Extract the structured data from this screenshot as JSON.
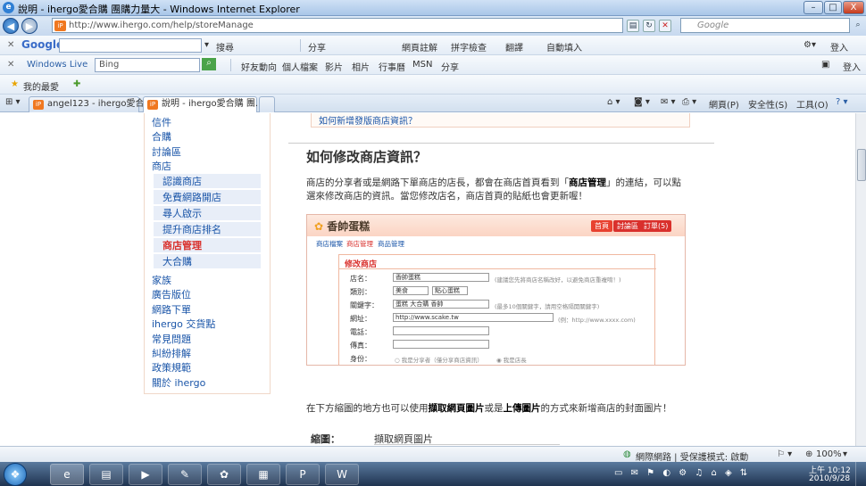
{
  "window": {
    "title": "說明 - ihergo愛合購 團購力量大 - Windows Internet Explorer",
    "controls": {
      "minimize": "–",
      "maximize": "□",
      "close": "X"
    }
  },
  "address_bar": {
    "url": "http://www.ihergo.com/help/storeManage",
    "search_placeholder": "Google"
  },
  "google_toolbar": {
    "logo": "Google",
    "items": [
      "搜尋",
      "分享",
      "網頁註解",
      "拼字檢查",
      "翻譯",
      "自動填入"
    ],
    "signin": "登入"
  },
  "live_toolbar": {
    "logo": "Windows Live",
    "search_value": "Bing",
    "links": [
      "好友動向",
      "個人檔案",
      "影片",
      "相片",
      "行事曆",
      "MSN",
      "分享"
    ],
    "signin": "登入"
  },
  "favorites_bar": {
    "label": "我的最愛"
  },
  "tabs": [
    {
      "label": "angel123 - ihergo愛合購",
      "active": false
    },
    {
      "label": "說明 - ihergo愛合購 團...",
      "active": true
    }
  ],
  "command_bar": {
    "page": "網頁(P)",
    "safety": "安全性(S)",
    "tools": "工具(O)"
  },
  "top_link": "如何新增發版商店資訊？",
  "sidebar": {
    "items_top": [
      "信件",
      "合購",
      "討論區",
      "商店"
    ],
    "sub_items": [
      "認識商店",
      "免費網路開店",
      "尋人啟示",
      "提升商店排名",
      "商店管理",
      "大合購"
    ],
    "current_sub": "商店管理",
    "items_bottom": [
      "家族",
      "廣告版位",
      "網路下單",
      "ihergo 交貨點",
      "常見問題",
      "糾紛排解",
      "政策規範",
      "關於 ihergo"
    ]
  },
  "article": {
    "heading": "如何修改商店資訊？",
    "para1_a": "商店的分享者或是網路下單商店的店長，都會在商店首頁看到「",
    "para1_bold": "商店管理",
    "para1_b": "」的連結，可以點",
    "para2": "選來修改商店的資訊。當您修改店名，商店首頁的貼紙也會更新喔！",
    "para3_a": "在下方縮圖的地方也可以使用",
    "para3_bold1": "擷取網頁圖片",
    "para3_b": "或是",
    "para3_bold2": "上傳圖片",
    "para3_c": "的方式來新增商店的封面圖片！",
    "thumb_label": "縮圖：",
    "thumb_value": "擷取網頁圖片"
  },
  "embedded": {
    "store_name": "香帥蛋糕",
    "buttons": [
      "首頁",
      "討論區",
      "訂單(5)"
    ],
    "sub_links": [
      "商店檔案",
      "商店管理",
      "商品管理"
    ],
    "form_title": "修改商店",
    "fields": [
      {
        "label": "店名：",
        "value": "香帥蛋糕",
        "note": "(建議您先將商店名稱改好，以避免商店重複唷！)"
      },
      {
        "label": "類別：",
        "value": "美食",
        "value2": "點心蛋糕",
        "note": ""
      },
      {
        "label": "關鍵字：",
        "value": "蛋糕 大合購 香帥",
        "note": "(最多10個關鍵字，請用空格隔開關鍵字)"
      },
      {
        "label": "網址：",
        "value": "http://www.scake.tw",
        "note": "(例：http://www.xxxx.com)"
      },
      {
        "label": "電話：",
        "value": "",
        "note": ""
      },
      {
        "label": "傳真：",
        "value": "",
        "note": ""
      },
      {
        "label": "身份：",
        "value": "",
        "note": ""
      }
    ],
    "identity_options": [
      "我是分享者（僅分享商店資訊）",
      "我是店長"
    ]
  },
  "status_bar": {
    "zone": "網際網路 | 受保護模式: 啟動",
    "zoom": "100%"
  },
  "taskbar": {
    "time": "上午 10:12",
    "date": "2010/9/28"
  },
  "colors": {
    "accent_red": "#d9302c",
    "link_blue": "#1a55a8",
    "brand_orange": "#f07820"
  }
}
